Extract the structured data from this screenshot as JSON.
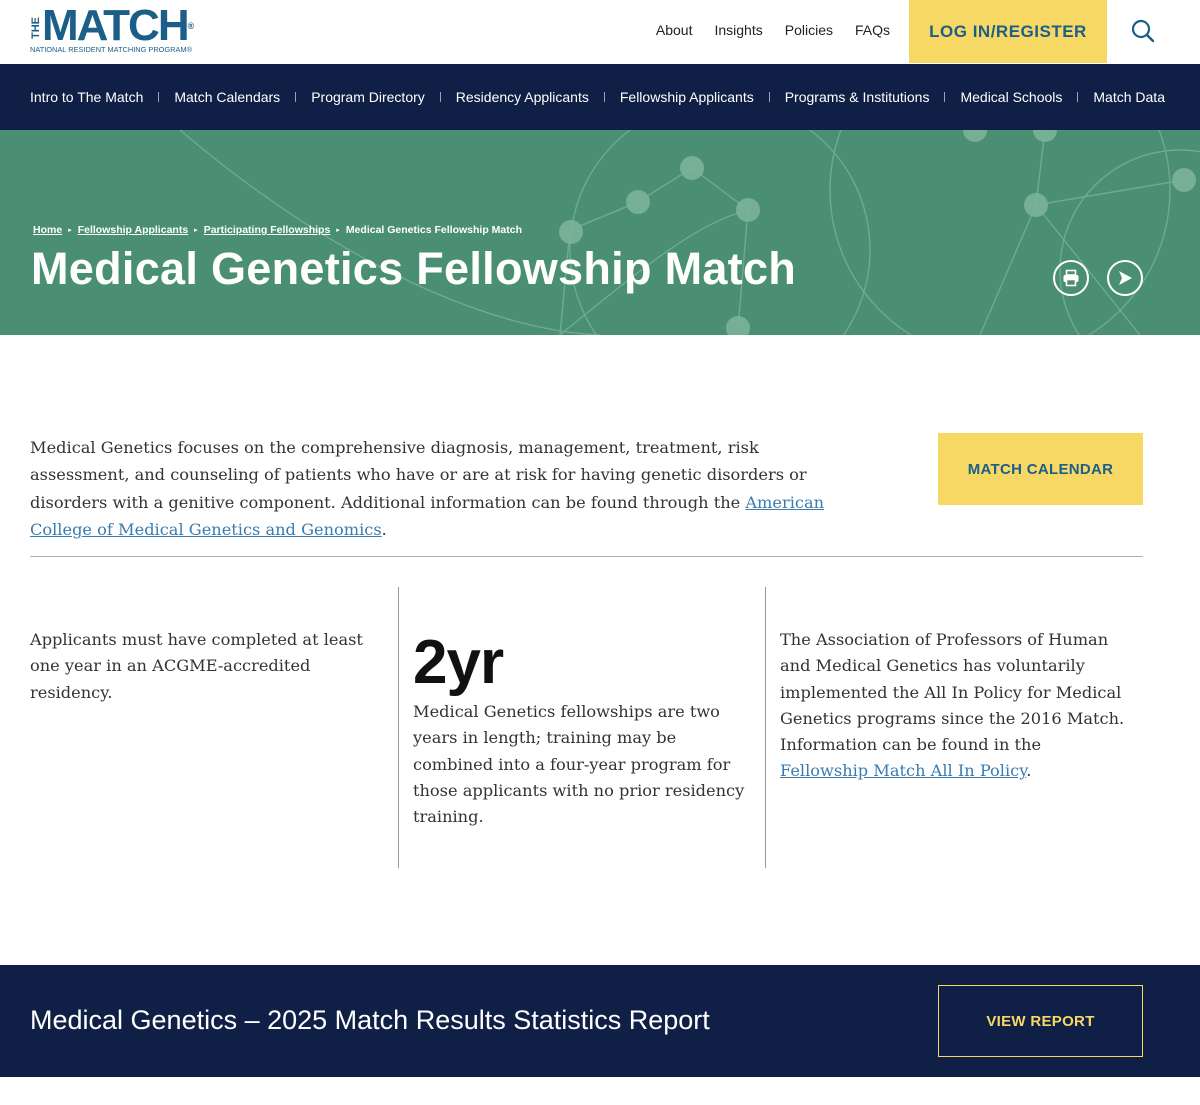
{
  "header": {
    "logo": {
      "the": "THE",
      "match": "MATCH",
      "tm": "®",
      "subtitle": "NATIONAL RESIDENT MATCHING PROGRAM®"
    },
    "links": [
      "About",
      "Insights",
      "Policies",
      "FAQs"
    ],
    "login_label": "LOG IN/REGISTER",
    "search_icon": "search-icon"
  },
  "nav": {
    "items": [
      "Intro to The Match",
      "Match Calendars",
      "Program Directory",
      "Residency Applicants",
      "Fellowship Applicants",
      "Programs & Institutions",
      "Medical Schools",
      "Match Data"
    ]
  },
  "hero": {
    "breadcrumb": {
      "home": "Home",
      "fellowship_applicants": "Fellowship Applicants",
      "participating_fellowships": "Participating Fellowships",
      "current": "Medical Genetics Fellowship Match"
    },
    "title": "Medical Genetics Fellowship Match",
    "print_icon": "print-icon",
    "share_icon": "share-icon"
  },
  "intro": {
    "text_before_link": "Medical Genetics focuses on the comprehensive diagnosis, management, treatment, risk assessment, and counseling of patients who have or are at risk for having genetic disorders or disorders with a genitive component. Additional information can be found through the ",
    "link_text": "American College of Medical Genetics and Genomics",
    "text_after_link": ".",
    "calendar_button": "MATCH CALENDAR"
  },
  "columns": {
    "col1": "Applicants must have completed at least one year in an ACGME-accredited residency.",
    "col2_stat": "2yr",
    "col2_text": "Medical Genetics fellowships are two years in length; training may be combined into a four-year program for those applicants with no prior residency training.",
    "col3_text_before_link": "The Association of Professors of Human and Medical Genetics has voluntarily implemented the All In Policy for Medical Genetics programs since the 2016 Match. Information can be found in the ",
    "col3_link": "Fellowship Match All In Policy",
    "col3_text_after_link": "."
  },
  "report": {
    "title": "Medical Genetics – 2025 Match Results Statistics Report",
    "button": "VIEW REPORT"
  },
  "colors": {
    "navy": "#0f1f45",
    "brand_blue": "#1b5e87",
    "yellow": "#f8d865",
    "hero_green": "#4a8f73",
    "link_blue": "#3a7bb0"
  }
}
